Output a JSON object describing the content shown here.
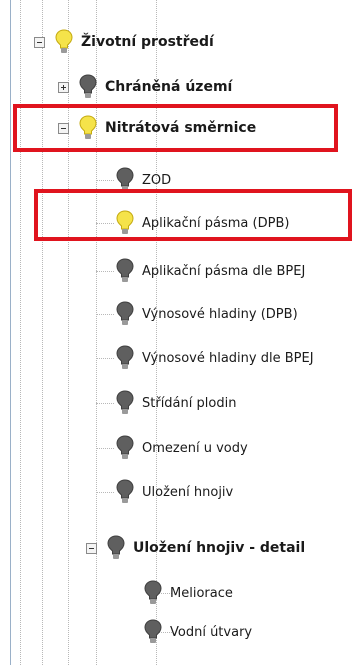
{
  "tree": {
    "root": {
      "label": "Životní prostředí",
      "expanded": true,
      "light": "on"
    },
    "groups": [
      {
        "label": "Chráněná území",
        "expanded": false,
        "light": "off"
      },
      {
        "label": "Nitrátová směrnice",
        "expanded": true,
        "light": "on",
        "highlighted": true
      }
    ],
    "nitrat_items": [
      {
        "label": "ZOD",
        "light": "off"
      },
      {
        "label": "Aplikační pásma (DPB)",
        "light": "on",
        "highlighted": true
      },
      {
        "label": "Aplikační pásma dle BPEJ",
        "light": "off"
      },
      {
        "label": "Výnosové hladiny (DPB)",
        "light": "off"
      },
      {
        "label": "Výnosové hladiny dle BPEJ",
        "light": "off"
      },
      {
        "label": "Střídání plodin",
        "light": "off"
      },
      {
        "label": "Omezení u vody",
        "light": "off"
      },
      {
        "label": "Uložení hnojiv",
        "light": "off"
      }
    ],
    "detail_group": {
      "label": "Uložení hnojiv - detail",
      "expanded": true,
      "light": "off"
    },
    "detail_items": [
      {
        "label": "Meliorace",
        "light": "off"
      },
      {
        "label": "Vodní útvary",
        "light": "off"
      }
    ]
  },
  "colors": {
    "highlight": "#e0141e",
    "bulb_on": "#f5e34a",
    "bulb_off": "#5f5f5f"
  },
  "icons": {
    "on": "lightbulb-on-icon",
    "off": "lightbulb-off-icon",
    "collapse": "minus-box-icon",
    "expand": "plus-box-icon"
  }
}
